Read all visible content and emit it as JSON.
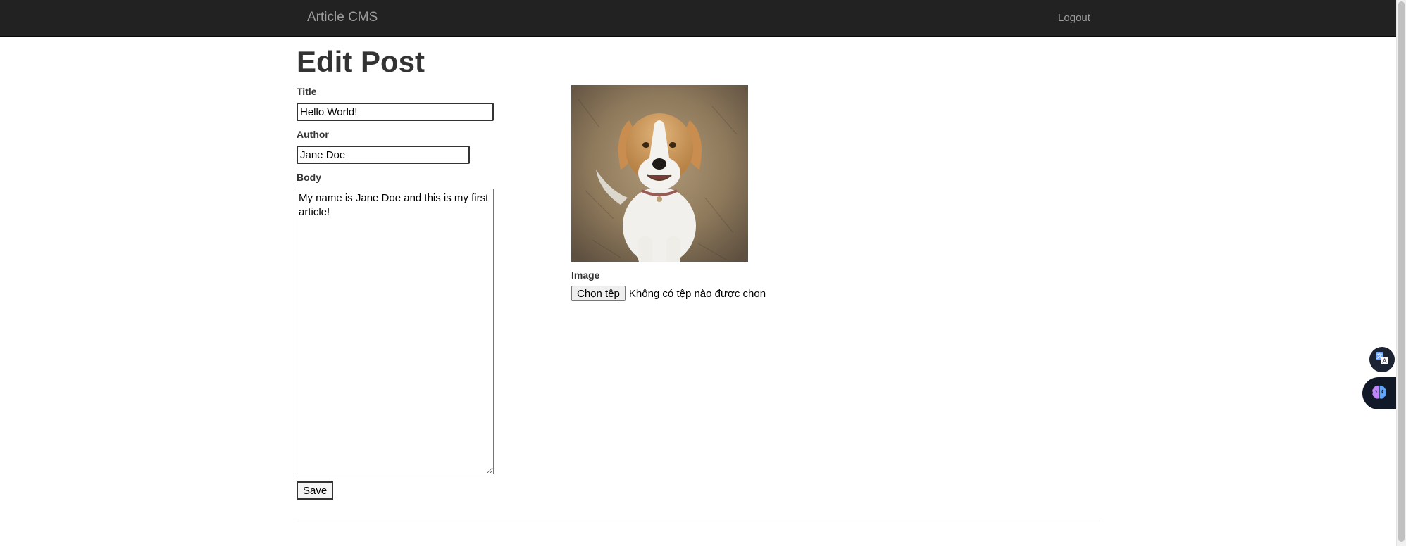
{
  "navbar": {
    "brand": "Article CMS",
    "logout_label": "Logout"
  },
  "page": {
    "title": "Edit Post"
  },
  "form": {
    "title_label": "Title",
    "title_value": "Hello World!",
    "author_label": "Author",
    "author_value": "Jane Doe",
    "body_label": "Body",
    "body_value": "My name is Jane Doe and this is my first article!",
    "save_label": "Save",
    "image_label": "Image",
    "file_button_label": "Chọn tệp",
    "file_status": "Không có tệp nào được chọn"
  },
  "floating": {
    "translate_icon": "translate-icon",
    "ai_icon": "brain-icon"
  },
  "colors": {
    "navbar_bg": "#222222",
    "navbar_text": "#9d9d9d",
    "text": "#333333"
  }
}
